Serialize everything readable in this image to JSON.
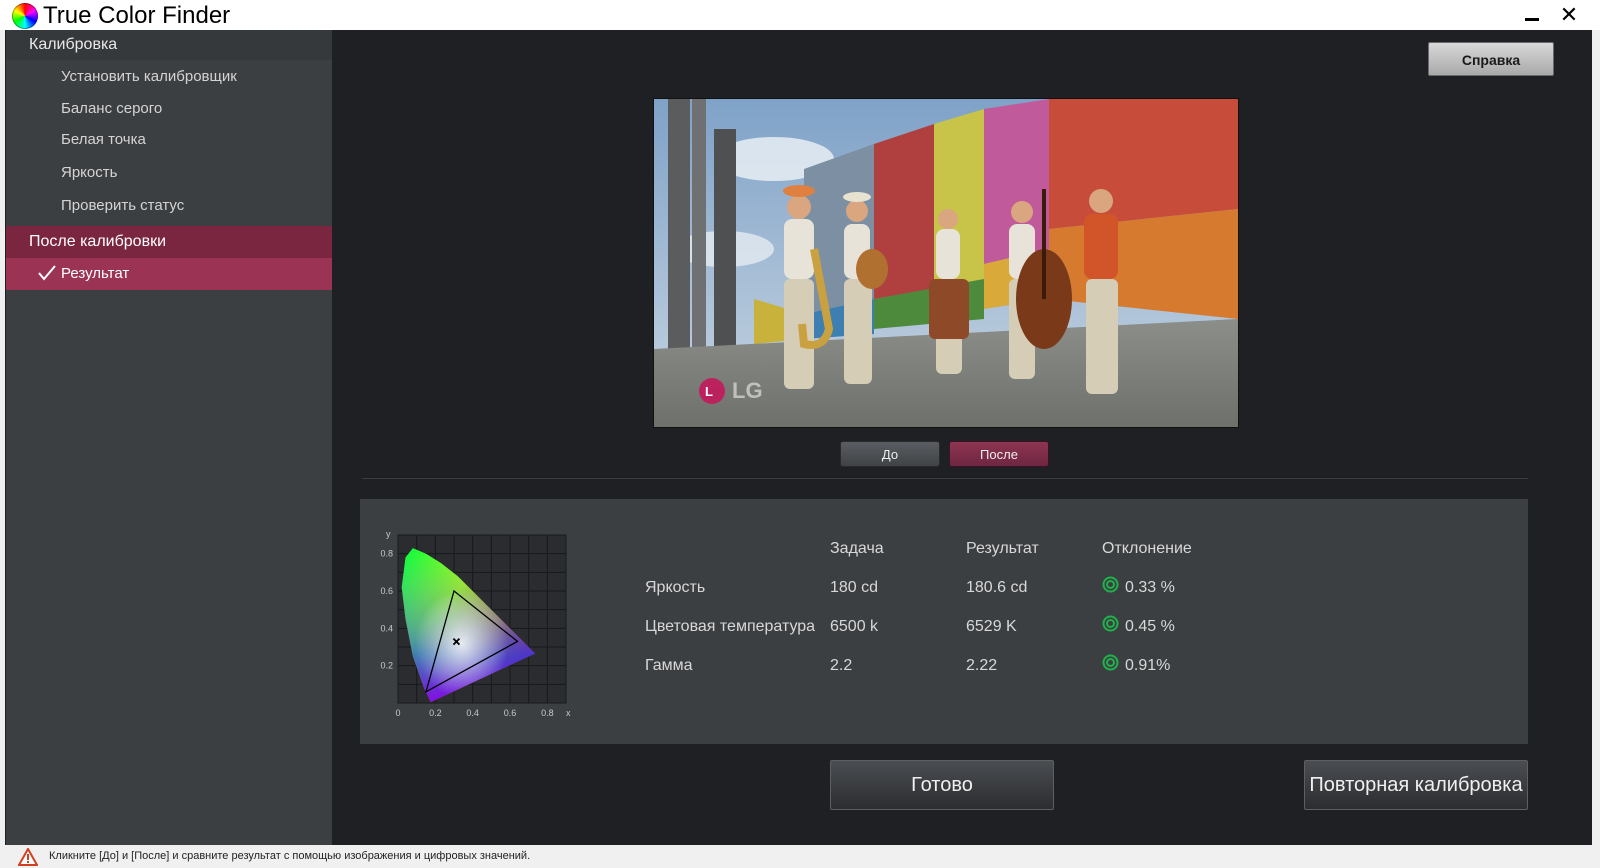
{
  "window": {
    "title": "True Color Finder",
    "minimize_label": "",
    "close_label": "✕"
  },
  "sidebar": {
    "section_calibration": "Калибровка",
    "items": [
      {
        "label": "Установить калибровщик"
      },
      {
        "label": "Баланс серого"
      },
      {
        "label": "Белая точка"
      },
      {
        "label": "Яркость"
      },
      {
        "label": "Проверить статус"
      }
    ],
    "section_after": "После калибровки",
    "active_item": "Результат"
  },
  "header": {
    "help_label": "Справка"
  },
  "preview": {
    "watermark": "LG",
    "before_label": "До",
    "after_label": "После",
    "selected": "after"
  },
  "results": {
    "columns": [
      "",
      "Задача",
      "Результат",
      "Отклонение"
    ],
    "rows": [
      {
        "name": "Яркость",
        "target": "180 cd",
        "result": "180.6 cd",
        "deviation": "0.33 %",
        "status": "ok"
      },
      {
        "name": "Цветовая температура",
        "target": "6500 k",
        "result": "6529 K",
        "deviation": "0.45 %",
        "status": "ok"
      },
      {
        "name": "Гамма",
        "target": "2.2",
        "result": "2.22",
        "deviation": "0.91%",
        "status": "ok"
      }
    ],
    "status_color": "#1fb24a"
  },
  "chart_data": {
    "type": "scatter",
    "title": "",
    "xlabel": "x",
    "ylabel": "y",
    "xlim": [
      0,
      0.9
    ],
    "ylim": [
      0,
      0.9
    ],
    "x_ticks": [
      "0",
      "0.2",
      "0.4",
      "0.6",
      "0.8"
    ],
    "y_ticks": [
      "0.2",
      "0.4",
      "0.6",
      "0.8"
    ],
    "grid": true,
    "gamut_triangle": [
      [
        0.64,
        0.33
      ],
      [
        0.3,
        0.6
      ],
      [
        0.15,
        0.06
      ]
    ],
    "white_point": [
      0.313,
      0.329
    ]
  },
  "actions": {
    "done_label": "Готово",
    "recalibrate_label": "Повторная калибровка"
  },
  "status_bar": {
    "message": "Кликните [До] и [После] и сравните результат с помощью изображения и цифровых значений."
  },
  "colors": {
    "accent": "#9b3454",
    "section_highlight": "#7a2640",
    "background": "#1e2024",
    "panel": "#3c3f42"
  }
}
